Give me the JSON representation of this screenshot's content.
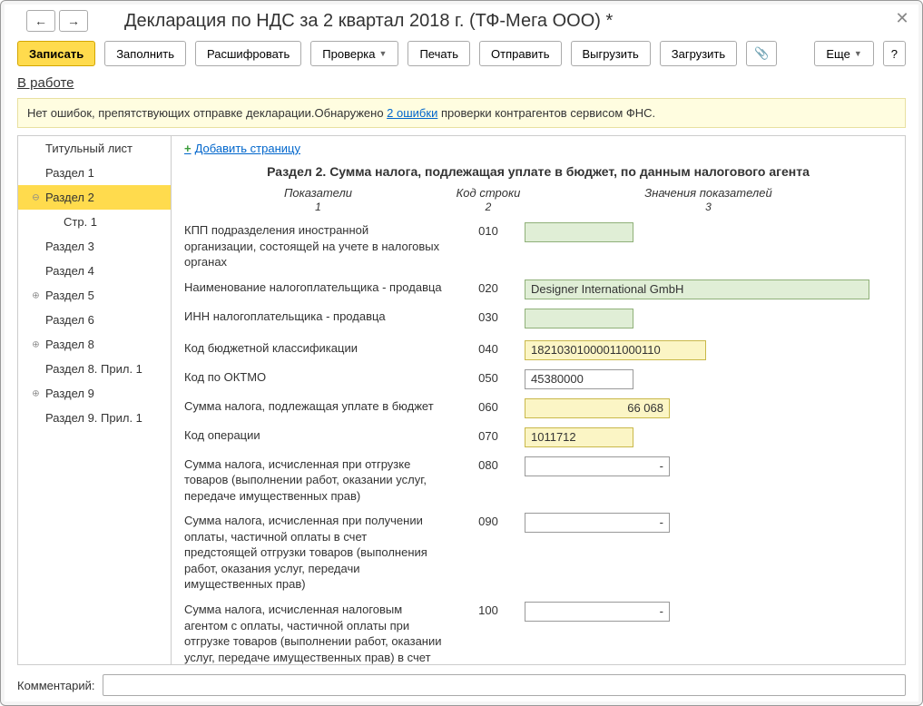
{
  "title": "Декларация по НДС за 2 квартал 2018 г. (ТФ-Мега ООО) *",
  "toolbar": {
    "write": "Записать",
    "fill": "Заполнить",
    "decode": "Расшифровать",
    "check": "Проверка",
    "print": "Печать",
    "send": "Отправить",
    "export": "Выгрузить",
    "import": "Загрузить",
    "more": "Еще"
  },
  "status_link": "В работе",
  "info_bar": {
    "prefix": "Нет ошибок, препятствующих отправке декларации.Обнаружено ",
    "link": "2 ошибки",
    "suffix": " проверки контрагентов сервисом ФНС."
  },
  "sidebar": [
    {
      "label": "Титульный лист",
      "tree": ""
    },
    {
      "label": "Раздел 1",
      "tree": ""
    },
    {
      "label": "Раздел 2",
      "tree": "⊖",
      "selected": true
    },
    {
      "label": "Стр. 1",
      "tree": "",
      "indent": true
    },
    {
      "label": "Раздел 3",
      "tree": ""
    },
    {
      "label": "Раздел 4",
      "tree": ""
    },
    {
      "label": "Раздел 5",
      "tree": "⊕"
    },
    {
      "label": "Раздел 6",
      "tree": ""
    },
    {
      "label": "Раздел 8",
      "tree": "⊕"
    },
    {
      "label": "Раздел 8. Прил. 1",
      "tree": ""
    },
    {
      "label": "Раздел 9",
      "tree": "⊕"
    },
    {
      "label": "Раздел 9. Прил. 1",
      "tree": ""
    }
  ],
  "content": {
    "add_page": "Добавить страницу",
    "section_title": "Раздел 2. Сумма налога, подлежащая уплате в бюджет, по данным налогового агента",
    "headers": {
      "col1": "Показатели",
      "col1_sub": "1",
      "col2": "Код строки",
      "col2_sub": "2",
      "col3": "Значения показателей",
      "col3_sub": "3"
    },
    "rows": [
      {
        "label": "КПП подразделения иностранной организации, состоящей на учете в налоговых органах",
        "code": "010",
        "value": "",
        "cls": "green short"
      },
      {
        "label": "Наименование налогоплательщика - продавца",
        "code": "020",
        "value": "Designer International GmbH",
        "cls": "green wide"
      },
      {
        "label": "ИНН налогоплательщика - продавца",
        "code": "030",
        "value": "",
        "cls": "green short"
      },
      {
        "label": "Код бюджетной классификации",
        "code": "040",
        "value": "18210301000011000110",
        "cls": "yellow med"
      },
      {
        "label": "Код по ОКТМО",
        "code": "050",
        "value": "45380000",
        "cls": "short"
      },
      {
        "label": "Сумма налога, подлежащая уплате в бюджет",
        "code": "060",
        "value": "66 068",
        "cls": "yellow num"
      },
      {
        "label": "Код операции",
        "code": "070",
        "value": "1011712",
        "cls": "yellow short"
      },
      {
        "label": "Сумма налога, исчисленная при отгрузке товаров (выполнении работ, оказании услуг, передаче имущественных прав)",
        "code": "080",
        "value": "",
        "cls": "num dash"
      },
      {
        "label": "Сумма налога, исчисленная при получении оплаты, частичной оплаты в счет предстоящей отгрузки товаров (выполнения работ, оказания услуг, передачи имущественных прав)",
        "code": "090",
        "value": "",
        "cls": "num dash"
      },
      {
        "label": "Сумма налога, исчисленная налоговым агентом с оплаты, частичной оплаты при отгрузке товаров (выполнении работ, оказании услуг, передаче имущественных прав) в счет этой оплаты, частичной оплаты",
        "code": "100",
        "value": "",
        "cls": "num dash"
      }
    ]
  },
  "footer": {
    "comment_label": "Комментарий:"
  }
}
